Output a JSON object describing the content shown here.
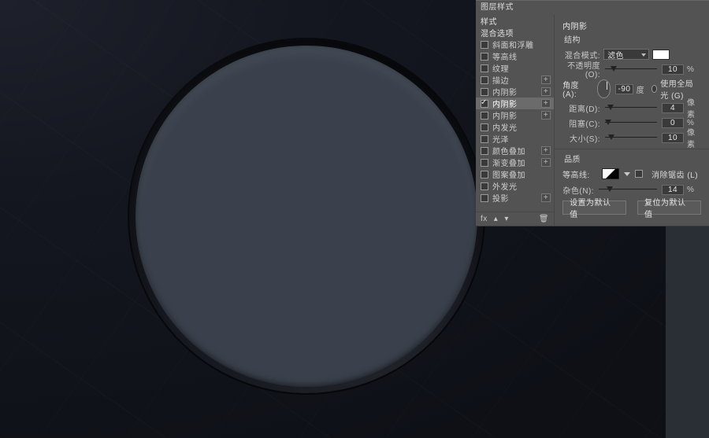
{
  "dialog": {
    "title": "图层样式",
    "styles_header": "样式",
    "blend_header": "混合选项",
    "effects": [
      {
        "key": "bevel",
        "label": "斜面和浮雕",
        "checked": false,
        "plus": false
      },
      {
        "key": "contour",
        "label": "等高线",
        "checked": false,
        "plus": false
      },
      {
        "key": "texture",
        "label": "纹理",
        "checked": false,
        "plus": false
      },
      {
        "key": "stroke",
        "label": "描边",
        "checked": false,
        "plus": true
      },
      {
        "key": "ishadow",
        "label": "内阴影",
        "checked": false,
        "plus": true
      },
      {
        "key": "ishadow2",
        "label": "内阴影",
        "checked": true,
        "plus": true
      },
      {
        "key": "ishadow3",
        "label": "内阴影",
        "checked": false,
        "plus": true
      },
      {
        "key": "iglow",
        "label": "内发光",
        "checked": false,
        "plus": false
      },
      {
        "key": "satin",
        "label": "光泽",
        "checked": false,
        "plus": false
      },
      {
        "key": "coverlay",
        "label": "颜色叠加",
        "checked": false,
        "plus": true
      },
      {
        "key": "goverlay",
        "label": "渐变叠加",
        "checked": false,
        "plus": true
      },
      {
        "key": "poverlay",
        "label": "图案叠加",
        "checked": false,
        "plus": false
      },
      {
        "key": "oglow",
        "label": "外发光",
        "checked": false,
        "plus": false
      },
      {
        "key": "dshadow",
        "label": "投影",
        "checked": false,
        "plus": true
      }
    ],
    "selected_index": 5,
    "footer": {
      "fx": "fx",
      "up": "▴",
      "down": "▾",
      "trash": "🗑"
    }
  },
  "panel": {
    "title": "内阴影",
    "structure_title": "结构",
    "blend_label": "混合模式:",
    "blend_value": "滤色",
    "opacity_label": "不透明度(O):",
    "opacity_value": "10",
    "percent": "%",
    "angle_label": "角度(A):",
    "angle_value": "-90",
    "degree": "度",
    "global_label": "使用全局光 (G)",
    "distance_label": "距离(D):",
    "distance_value": "4",
    "px": "像素",
    "choke_label": "阻塞(C):",
    "choke_value": "0",
    "size_label": "大小(S):",
    "size_value": "10",
    "quality_title": "品质",
    "contour_label": "等高线:",
    "antialias_label": "消除锯齿 (L)",
    "noise_label": "杂色(N):",
    "noise_value": "14",
    "btn_default": "设置为默认值",
    "btn_reset": "复位为默认值"
  },
  "colors": {
    "swatch": "#ffffff"
  }
}
